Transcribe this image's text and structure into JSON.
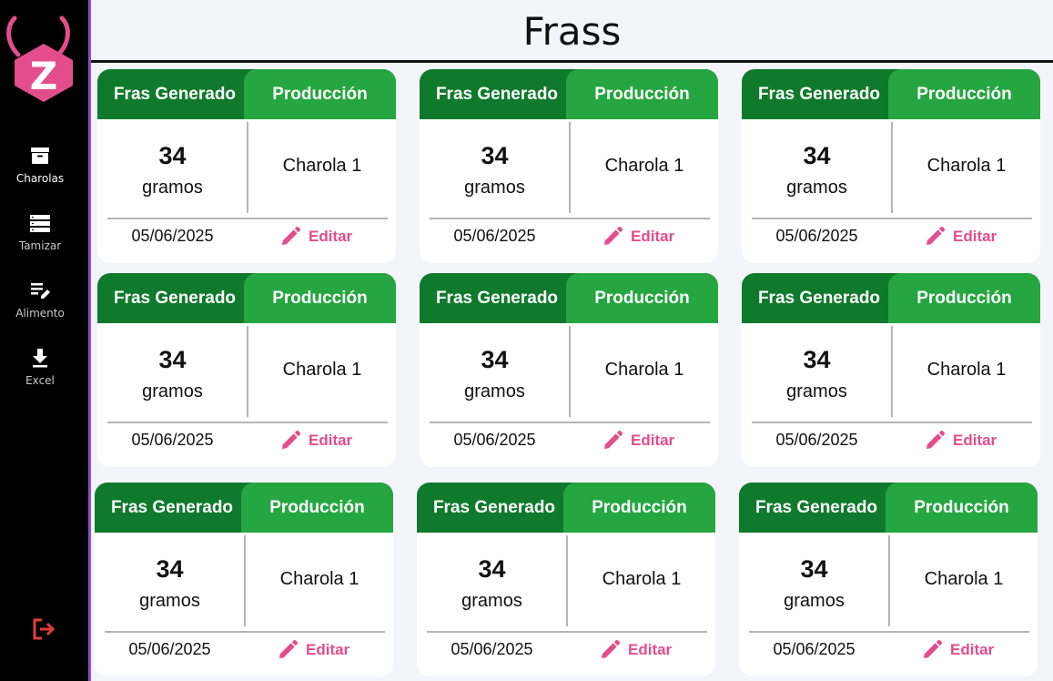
{
  "page": {
    "title": "Frass"
  },
  "sidebar": {
    "logo_letter": "Z",
    "items": [
      {
        "label": "Charolas",
        "icon": "archive-icon",
        "active": true
      },
      {
        "label": "Tamizar",
        "icon": "list-icon",
        "active": false
      },
      {
        "label": "Alimento",
        "icon": "edit-note-icon",
        "active": false
      },
      {
        "label": "Excel",
        "icon": "download-icon",
        "active": false
      }
    ],
    "logout_icon": "logout-icon"
  },
  "colors": {
    "header_dark": "#0f7a2c",
    "header_light": "#25a640",
    "accent": "#e34d8c",
    "sidebar_bg": "#000000",
    "sidebar_border": "#8a4fd8"
  },
  "cards": [
    {
      "header_left": "Fras Generado",
      "header_right": "Producción",
      "amount": "34",
      "unit": "gramos",
      "tray": "Charola 1",
      "date": "05/06/2025",
      "edit_label": "Editar"
    },
    {
      "header_left": "Fras Generado",
      "header_right": "Producción",
      "amount": "34",
      "unit": "gramos",
      "tray": "Charola 1",
      "date": "05/06/2025",
      "edit_label": "Editar"
    },
    {
      "header_left": "Fras Generado",
      "header_right": "Producción",
      "amount": "34",
      "unit": "gramos",
      "tray": "Charola 1",
      "date": "05/06/2025",
      "edit_label": "Editar"
    },
    {
      "header_left": "Fras Generado",
      "header_right": "Producción",
      "amount": "34",
      "unit": "gramos",
      "tray": "Charola 1",
      "date": "05/06/2025",
      "edit_label": "Editar"
    },
    {
      "header_left": "Fras Generado",
      "header_right": "Producción",
      "amount": "34",
      "unit": "gramos",
      "tray": "Charola 1",
      "date": "05/06/2025",
      "edit_label": "Editar"
    },
    {
      "header_left": "Fras Generado",
      "header_right": "Producción",
      "amount": "34",
      "unit": "gramos",
      "tray": "Charola 1",
      "date": "05/06/2025",
      "edit_label": "Editar"
    },
    {
      "header_left": "Fras Generado",
      "header_right": "Producción",
      "amount": "34",
      "unit": "gramos",
      "tray": "Charola 1",
      "date": "05/06/2025",
      "edit_label": "Editar"
    },
    {
      "header_left": "Fras Generado",
      "header_right": "Producción",
      "amount": "34",
      "unit": "gramos",
      "tray": "Charola 1",
      "date": "05/06/2025",
      "edit_label": "Editar"
    },
    {
      "header_left": "Fras Generado",
      "header_right": "Producción",
      "amount": "34",
      "unit": "gramos",
      "tray": "Charola 1",
      "date": "05/06/2025",
      "edit_label": "Editar"
    }
  ]
}
